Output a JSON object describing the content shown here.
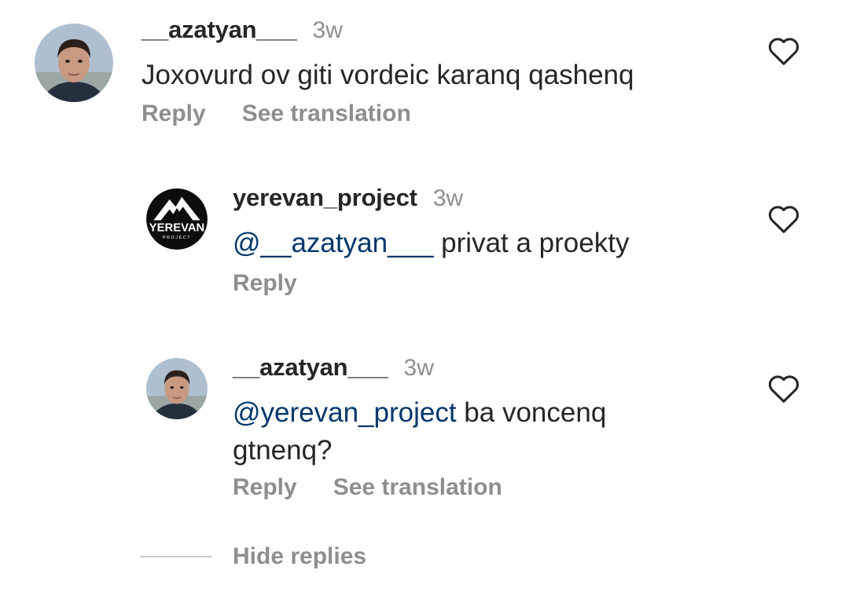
{
  "comments": [
    {
      "username": "__azatyan___",
      "time": "3w",
      "mention": "",
      "text": "Joxovurd ov giti vordeic karanq qashenq",
      "actions": [
        "Reply",
        "See translation"
      ]
    },
    {
      "username": "yerevan_project",
      "time": "3w",
      "mention": "@__azatyan___",
      "text": " privat a proekty",
      "actions": [
        "Reply"
      ],
      "avatar_logo_text": "YEREVAN",
      "avatar_logo_subtext": "PROJECT"
    },
    {
      "username": "__azatyan___",
      "time": "3w",
      "mention": "@yerevan_project",
      "text": " ba voncenq gtnenq?",
      "actions": [
        "Reply",
        "See translation"
      ]
    }
  ],
  "hide_replies": "Hide replies",
  "colors": {
    "text": "#262626",
    "secondary": "#8e8e8e",
    "mention": "#00376b",
    "divider": "#c7c7c7"
  },
  "icons": {
    "like": "heart-outline-icon"
  }
}
